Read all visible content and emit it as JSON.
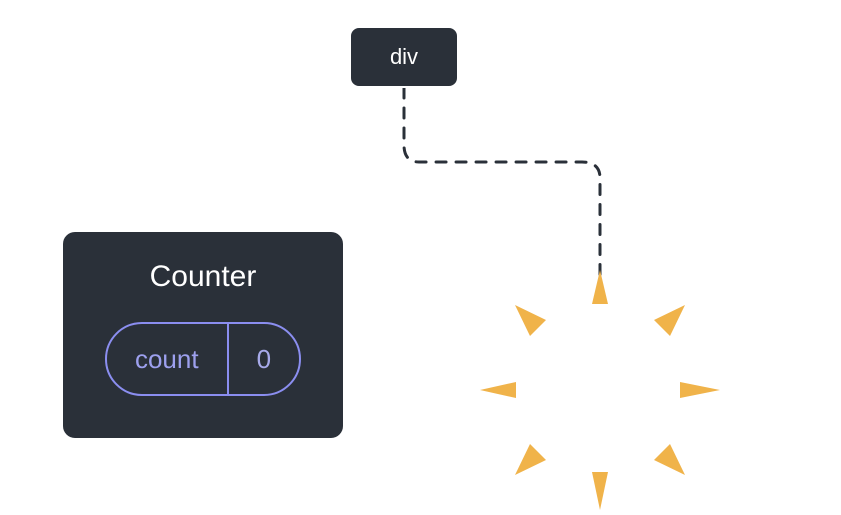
{
  "root": {
    "label": "div"
  },
  "counter": {
    "title": "Counter",
    "state_key": "count",
    "state_value": "0"
  }
}
